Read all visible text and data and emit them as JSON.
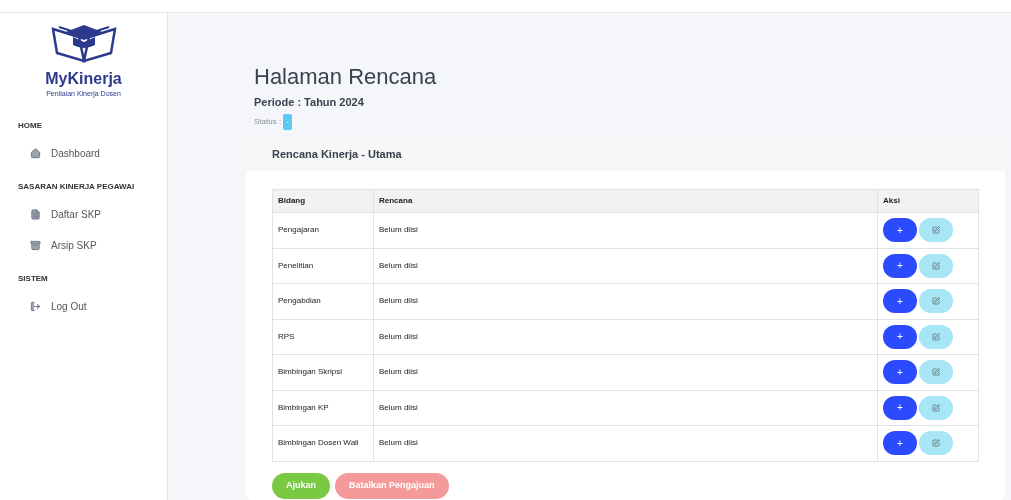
{
  "sidebar": {
    "brand": "MyKinerja",
    "tagline": "Penilaian Kinerja Dosen",
    "sections": [
      {
        "heading": "HOME",
        "items": [
          {
            "label": "Dashboard",
            "kind": "home"
          }
        ]
      },
      {
        "heading": "SASARAN KINERJA PEGAWAI",
        "items": [
          {
            "label": "Daftar SKP",
            "kind": "file"
          },
          {
            "label": "Arsip SKP",
            "kind": "archive"
          }
        ]
      },
      {
        "heading": "SISTEM",
        "items": [
          {
            "label": "Log Out",
            "kind": "logout"
          }
        ]
      }
    ]
  },
  "page": {
    "title": "Halaman Rencana",
    "period": "Periode : Tahun 2024",
    "status_label": "Status :",
    "status_value": "-"
  },
  "card": {
    "title": "Rencana Kinerja - Utama",
    "table": {
      "columns": [
        "Bidang",
        "Rencana",
        "Aksi"
      ],
      "rows": [
        {
          "bidang": "Pengajaran",
          "rencana": "Belum diisi",
          "add": "+"
        },
        {
          "bidang": "Penelitian",
          "rencana": "Belum diisi",
          "add": "+"
        },
        {
          "bidang": "Pengabdian",
          "rencana": "Belum diisi",
          "add": "+"
        },
        {
          "bidang": "RPS",
          "rencana": "Belum diisi",
          "add": "+"
        },
        {
          "bidang": "Bimbingan Skripsi",
          "rencana": "Belum diisi",
          "add": "+"
        },
        {
          "bidang": "Bimbingan KP",
          "rencana": "Belum diisi",
          "add": "+"
        },
        {
          "bidang": "Bimbingan Dosen Wali",
          "rencana": "Belum diisi",
          "add": "+"
        }
      ]
    },
    "buttons": [
      {
        "label": "Ajukan",
        "kind": "submit"
      },
      {
        "label": "Batalkan Pengajuan",
        "kind": "cancel"
      }
    ]
  }
}
